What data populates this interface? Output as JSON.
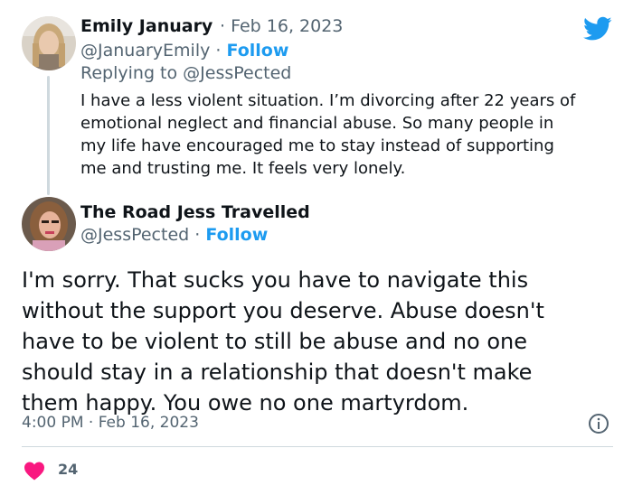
{
  "reply_tweet": {
    "display_name": "Emily January",
    "date_separator": "·",
    "date": "Feb 16, 2023",
    "handle": "@JanuaryEmily",
    "follow_separator": "·",
    "follow_label": "Follow",
    "replying_to": "Replying to @JessPected",
    "text_lines": [
      "I have a less violent situation. I’m divorcing after 22 years of",
      "emotional neglect and financial abuse. So many people in",
      "my life have encouraged me to stay instead of supporting",
      "me and trusting me. It feels very lonely."
    ]
  },
  "main_tweet": {
    "display_name": "The Road Jess Travelled",
    "handle": "@JessPected",
    "follow_separator": "·",
    "follow_label": "Follow",
    "text_lines": [
      "I'm sorry. That sucks you have to navigate this",
      "without the support you deserve. Abuse doesn't",
      "have to be violent to still be abuse and no one",
      "should stay in a relationship that doesn't make",
      "them happy. You owe no one martyrdom."
    ],
    "timestamp": "4:00 PM · Feb 16, 2023",
    "like_count": "24"
  },
  "colors": {
    "twitter_blue": "#1d9bf0",
    "heart_red": "#f91880",
    "secondary_text": "#536471"
  },
  "icons": [
    "twitter-logo-icon",
    "info-icon",
    "heart-icon"
  ]
}
